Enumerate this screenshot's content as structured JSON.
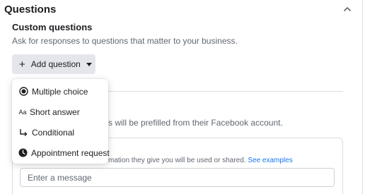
{
  "section": {
    "title": "Questions"
  },
  "custom_questions": {
    "title": "Custom questions",
    "subtitle": "Ask for responses to questions that matter to your business.",
    "add_button_label": "Add question"
  },
  "dropdown": {
    "items": [
      {
        "label": "Multiple choice",
        "icon": "radio-button-icon"
      },
      {
        "label": "Short answer",
        "icon": "text-aa-icon",
        "icon_text": "Aa"
      },
      {
        "label": "Conditional",
        "icon": "conditional-arrow-icon"
      },
      {
        "label": "Appointment request",
        "icon": "clock-icon"
      }
    ]
  },
  "prefill": {
    "visible_text": "s will be prefilled from their Facebook account."
  },
  "message_card": {
    "note_visible": "mation they give you will be used or shared.",
    "link_label": "See examples",
    "input_placeholder": "Enter a message"
  },
  "colors": {
    "link": "#1877f2",
    "button_bg": "#e4e6eb",
    "muted_text": "#606770"
  }
}
